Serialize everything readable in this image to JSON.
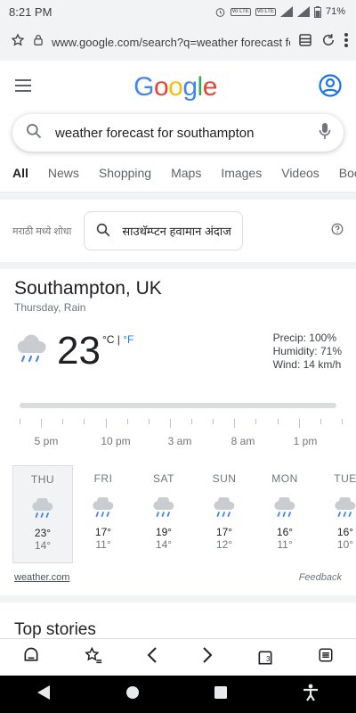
{
  "status_bar": {
    "time": "8:21 PM",
    "volte1": "Vo LTE",
    "volte2": "Vo LTE",
    "battery": "71%"
  },
  "browser": {
    "url": "www.google.com/search?q=weather forecast for s"
  },
  "google": {
    "logo": [
      "G",
      "o",
      "o",
      "g",
      "l",
      "e"
    ],
    "logo_colors": [
      "#4285F4",
      "#EA4335",
      "#FBBC05",
      "#4285F4",
      "#34A853",
      "#EA4335"
    ],
    "query": "weather forecast for southampton",
    "tabs": [
      "All",
      "News",
      "Shopping",
      "Maps",
      "Images",
      "Videos",
      "Boo"
    ]
  },
  "marathi": {
    "label": "मराठी मध्ये शोधा",
    "chip": "साउथॅम्प्टन हवामान अंदाज"
  },
  "weather": {
    "location": "Southampton, UK",
    "daytime": "Thursday, Rain",
    "temp": "23",
    "unit_c": "°C",
    "unit_sep": "|",
    "unit_f": "°F",
    "precip": "Precip: 100%",
    "humidity": "Humidity: 71%",
    "wind": "Wind: 14 km/h",
    "hours": [
      "5 pm",
      "10 pm",
      "3 am",
      "8 am",
      "1 pm"
    ],
    "days": [
      {
        "name": "THU",
        "hi": "23°",
        "lo": "14°"
      },
      {
        "name": "FRI",
        "hi": "17°",
        "lo": "11°"
      },
      {
        "name": "SAT",
        "hi": "19°",
        "lo": "14°"
      },
      {
        "name": "SUN",
        "hi": "17°",
        "lo": "12°"
      },
      {
        "name": "MON",
        "hi": "16°",
        "lo": "11°"
      },
      {
        "name": "TUE",
        "hi": "16°",
        "lo": "10°"
      }
    ],
    "source": "weather.com",
    "feedback": "Feedback"
  },
  "top_stories": {
    "title": "Top stories"
  },
  "bottom_bar": {
    "tabs_count": "3"
  },
  "colors": {
    "accent": "#1a73e8",
    "selected_day_bg": "#f1f3f4"
  }
}
